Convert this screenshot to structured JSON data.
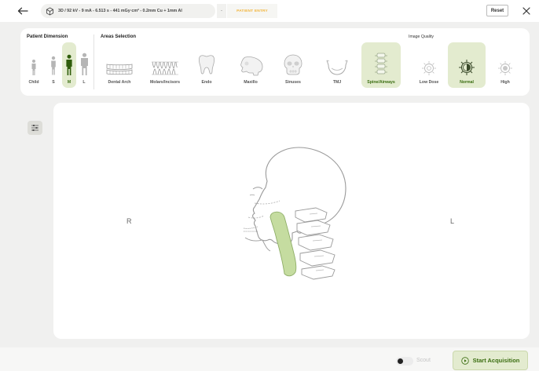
{
  "header": {
    "params": "3D / 92 kV - 9 mA - 6.513 s - 441 mGy·cm² - 0.2mm Cu + 1mm Al",
    "separator": "-",
    "entry_label": "PATIENT ENTRY",
    "reset_label": "Reset",
    "back_icon": "arrow-left-icon",
    "close_icon": "close-icon"
  },
  "patient_dimension": {
    "title": "Patient Dimension",
    "options": [
      "Child",
      "S",
      "M",
      "L"
    ],
    "selected": "M"
  },
  "areas_selection": {
    "title": "Areas Selection",
    "options": [
      "Dental Arch",
      "Molars/Incisors",
      "Endo",
      "Maxillo",
      "Sinuses",
      "TMJ",
      "Spine/Airways"
    ],
    "selected": "Spine/Airways"
  },
  "image_quality": {
    "title": "Image Quality",
    "options": [
      "Low Dose",
      "Normal",
      "High"
    ],
    "selected": "Normal"
  },
  "canvas": {
    "left_label": "R",
    "right_label": "L"
  },
  "footer": {
    "scout_label": "Scout",
    "scout_on": false,
    "start_label": "Start Acquisition"
  },
  "colors": {
    "accent_bg": "#e3ebcf",
    "accent_text": "#3a6d10",
    "highlight": "#c5dca0",
    "entry": "#f2b43a"
  }
}
